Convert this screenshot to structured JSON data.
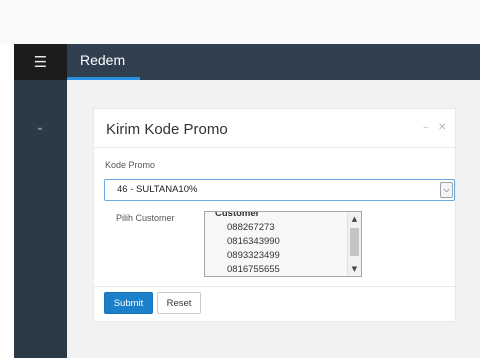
{
  "header": {
    "menu_icon": "menu-icon",
    "brand": "Redem"
  },
  "sidebar": {
    "expand_icon": "chevron-down-icon"
  },
  "panel": {
    "title": "Kirim Kode Promo",
    "tools": [
      "minimize-icon",
      "close-icon"
    ],
    "form": {
      "kode_promo_label": "Kode Promo",
      "kode_promo_value": "46 - SULTANA10%",
      "customer_label": "Pilih Customer",
      "customer_group": "Customer",
      "customers": [
        "088267273",
        "0816343990",
        "0893323499",
        "0816755655"
      ]
    },
    "buttons": {
      "submit": "Submit",
      "reset": "Reset"
    }
  },
  "colors": {
    "topbar": "#2f3f4f",
    "sidebar": "#2c3a47",
    "accent": "#2a8fe0",
    "primary_button": "#1b7fc9"
  }
}
